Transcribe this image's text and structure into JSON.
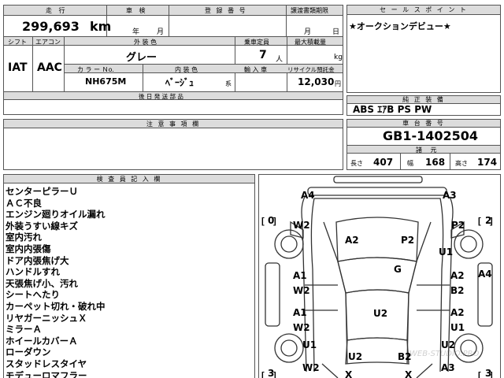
{
  "header": {
    "mileage_label": "走 行",
    "mileage_value": "299,693",
    "mileage_unit": "km",
    "inspection_label": "車 検",
    "inspection_year": "年",
    "inspection_month": "月",
    "registration_label": "登 録 番 号",
    "transfer_label": "譲渡書類期限",
    "transfer_month": "月",
    "transfer_day": "日"
  },
  "row2": {
    "shift_label": "シフト",
    "shift_value": "IAT",
    "aircon_label": "エアコン",
    "aircon_value": "AAC",
    "ext_color_label": "外 装 色",
    "ext_color_value": "グレー",
    "capacity_label": "乗車定員",
    "capacity_value": "7",
    "capacity_unit": "人",
    "loadcap_label": "最大積載量",
    "loadcap_unit": "kg",
    "colorno_label": "カ ラ ー Ｎo.",
    "colorno_value": "NH675M",
    "int_color_label": "内 装 色",
    "int_color_value": "ﾍﾞｰｼﾞｭ",
    "int_color_suffix": "系",
    "import_label": "輸 入 車",
    "recycle_label": "リサイクル預託金",
    "recycle_value": "12,030",
    "recycle_unit": "円",
    "later_docs_label": "後 日 発 送 部 品"
  },
  "sales": {
    "label": "セ ー ル ス ポ イ ン ト",
    "text": "★オークションデビュー★"
  },
  "equipment": {
    "label": "純 正 装 備",
    "text": "ABS ｴｱB PS PW"
  },
  "notes": {
    "label": "注 意 事 項 欄"
  },
  "chassis": {
    "label": "車 台 番 号",
    "value": "GB1-1402504",
    "dims_label": "諸 元",
    "length_label": "長さ",
    "length_value": "407",
    "width_label": "幅",
    "width_value": "168",
    "height_label": "高さ",
    "height_value": "174"
  },
  "inspector": {
    "label": "検 査 員 記 入 欄",
    "items": [
      "センターピラーＵ",
      "ＡＣ不良",
      "エンジン廻りオイル漏れ",
      "外装うすい線キズ",
      "室内汚れ",
      "室内内張傷",
      "ドア内張焦げ大",
      "ハンドルすれ",
      "天張焦げ小、汚れ",
      "シートへたり",
      "カーペット切れ・破れ中",
      "リヤガーニッシュＸ",
      "ミラーＡ",
      "ホイールカバーＡ",
      "ローダウン",
      "スタッドレスタイヤ",
      "モデューロマフラー"
    ]
  },
  "diagram": {
    "codes": {
      "a4_tl": "A4",
      "a3_tr": "A3",
      "w2_l1": "W2",
      "p2_r1": "P2",
      "a2_c": "A2",
      "p2_c": "P2",
      "u1_r1": "U1",
      "a4_r": "A4",
      "g_c": "G",
      "a1_l1": "A1",
      "a2_r2": "A2",
      "w2_l2": "W2",
      "b2_r": "B2",
      "u2_c": "U2",
      "a1_l2": "A1",
      "a2_r3": "A2",
      "w2_l3": "W2",
      "u1_r2": "U1",
      "u1_l": "U1",
      "u2_r": "U2",
      "u2_bl": "U2",
      "b2_b": "B2",
      "a3_b": "A3",
      "w2_l4": "W2",
      "x_b1": "X",
      "x_b2": "X"
    },
    "tread_fl": "0",
    "tread_rl": "3",
    "tread_rr": "3",
    "tread_fr": "2",
    "watermark": "WEB-STUDIO.PRO"
  }
}
